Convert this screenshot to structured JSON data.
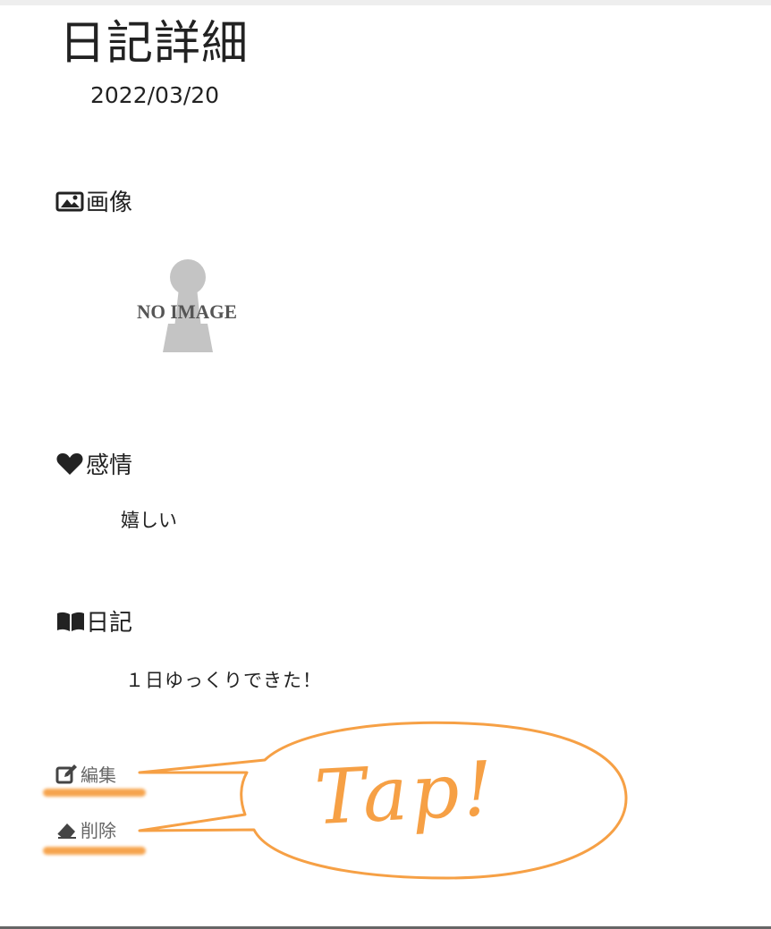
{
  "page": {
    "title": "日記詳細",
    "date": "2022/03/20"
  },
  "sections": {
    "image": {
      "label": "画像",
      "icon": "image-icon",
      "placeholder_text": "NO IMAGE"
    },
    "emotion": {
      "label": "感情",
      "icon": "heart-icon",
      "value": "嬉しい"
    },
    "diary": {
      "label": "日記",
      "icon": "book-icon",
      "value": "１日ゆっくりできた！"
    }
  },
  "actions": {
    "edit": {
      "label": "編集",
      "icon": "edit-icon"
    },
    "delete": {
      "label": "削除",
      "icon": "eraser-icon"
    }
  },
  "annotation": {
    "text": "Tap!",
    "color": "#f6a045"
  }
}
